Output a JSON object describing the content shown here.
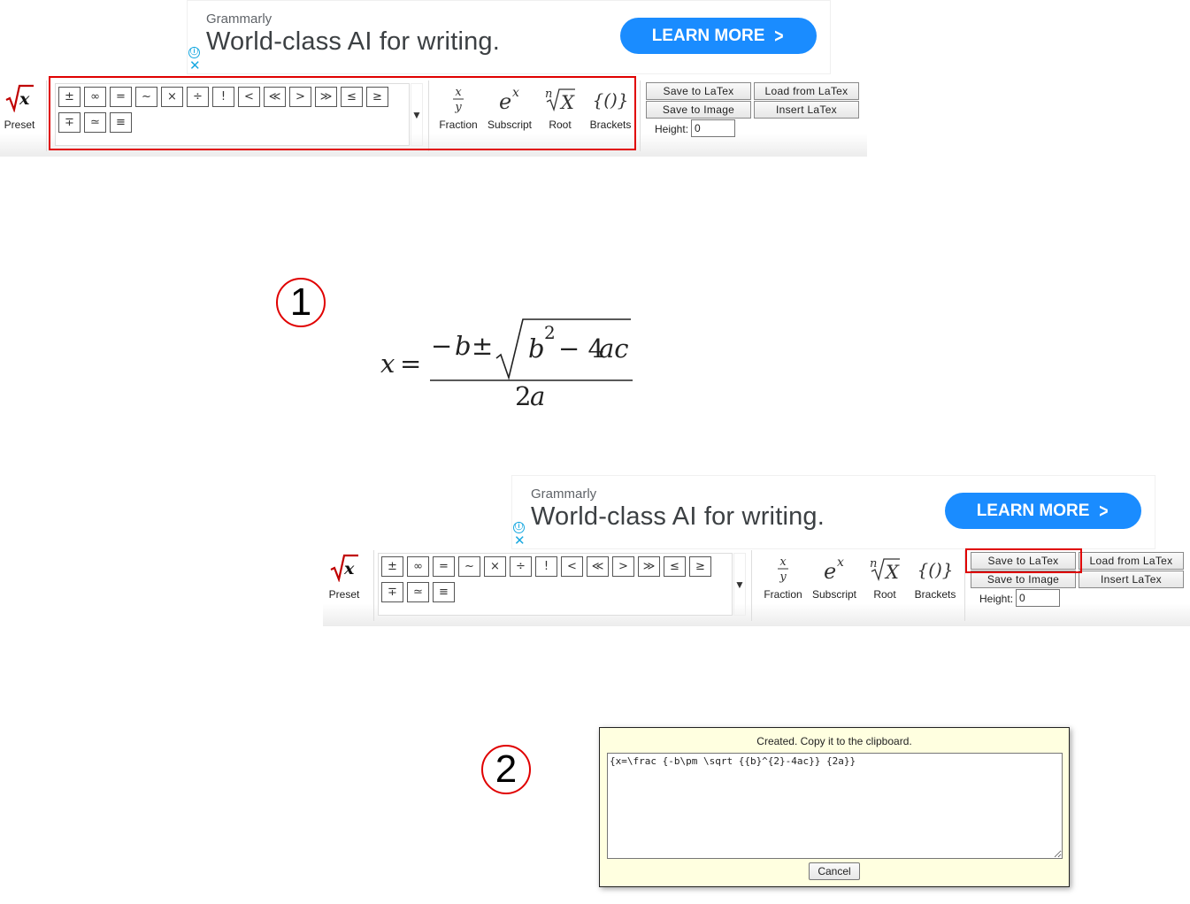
{
  "ad": {
    "brand": "Grammarly",
    "headline": "World-class AI for writing.",
    "cta": "LEARN MORE",
    "info_icon": "ⓘ",
    "close_icon": "✕",
    "accent": "#1a8cff"
  },
  "toolbar": {
    "preset_label": "Preset",
    "symbols": [
      "±",
      "∞",
      "=",
      "~",
      "×",
      "÷",
      "!",
      "<",
      "≪",
      ">",
      "≫",
      "≤",
      "≥",
      "∓",
      "≃",
      "≡"
    ],
    "more_arrow": "▼",
    "tools": {
      "fraction": "Fraction",
      "subscript": "Subscript",
      "root": "Root",
      "brackets": "Brackets"
    },
    "buttons": {
      "save_latex": "Save to LaTex",
      "load_latex": "Load from LaTex",
      "save_image": "Save to Image",
      "insert_latex": "Insert LaTex"
    },
    "height_label": "Height:",
    "height_value": "0"
  },
  "steps": {
    "one": "1",
    "two": "2"
  },
  "highlight_color": "#e00000",
  "formula": {
    "lhs_var": "x",
    "equals": "=",
    "neg": "−",
    "b": "b",
    "pm": "±",
    "b2": "b",
    "sup": "2",
    "minus4ac": "− 4",
    "ac": "ac",
    "denominator_coef": "2",
    "denominator_var": "a"
  },
  "dialog": {
    "message": "Created. Copy it to the clipboard.",
    "latex": "{x=\\frac {-b\\pm \\sqrt {{b}^{2}-4ac}} {2a}}",
    "cancel": "Cancel"
  }
}
